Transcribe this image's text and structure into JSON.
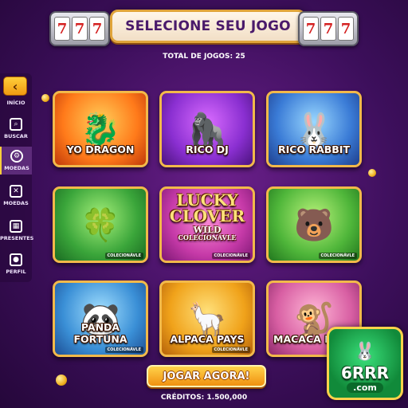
{
  "header": {
    "title": "SELECIONE SEU JOGO",
    "slot_symbols": [
      "7",
      "7",
      "7"
    ],
    "total_label": "TOTAL DE JOGOS: 25"
  },
  "sidebar": {
    "items": [
      {
        "label": "INÍCIO",
        "icon": "back-arrow-icon"
      },
      {
        "label": "BUSCAR",
        "icon": "search-icon"
      },
      {
        "label": "MOEDAS",
        "icon": "coins-gear-icon"
      },
      {
        "label": "MOEDAS",
        "icon": "coins-icon"
      },
      {
        "label": "PRESENTES",
        "icon": "gift-icon"
      },
      {
        "label": "PERFIL",
        "icon": "profile-icon"
      }
    ]
  },
  "games": [
    {
      "title": "YO DRAGON",
      "badge": ""
    },
    {
      "title": "RICO DJ",
      "badge": ""
    },
    {
      "title": "RICO RABBIT",
      "badge": ""
    },
    {
      "title": "",
      "badge": "COLECIONÁVLE"
    },
    {
      "title": "",
      "badge": "COLECIONÁVLE",
      "art_lines": [
        "LUCKY",
        "CLOVER",
        "WILD",
        "COLECIONÁVLE"
      ]
    },
    {
      "title": "",
      "badge": "COLECIONÁVLE"
    },
    {
      "title": "PANDA FORTUNA",
      "badge": "COLECIONÁVLE"
    },
    {
      "title": "ALPACA PAYS",
      "badge": "COLECIONÁVLE"
    },
    {
      "title": "MACACA MA",
      "badge": ""
    }
  ],
  "play_button": "JOGAR AGORA!",
  "credits": "CRÉDITOS: 1.500,000",
  "logo": {
    "brand": "6RRR",
    "domain": ".com"
  },
  "colors": {
    "background": "#3d0f5c",
    "accent": "#f2b94a",
    "button": "#f09a12"
  }
}
